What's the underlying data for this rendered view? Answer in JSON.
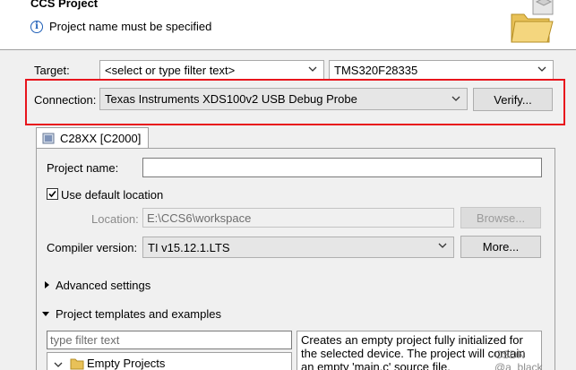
{
  "header": {
    "title": "CCS Project",
    "message": "Project name must be specified"
  },
  "target": {
    "label": "Target:",
    "filter_value": "<select or type filter text>",
    "device_value": "TMS320F28335"
  },
  "connection": {
    "label": "Connection:",
    "value": "Texas Instruments XDS100v2 USB Debug Probe",
    "verify_label": "Verify..."
  },
  "tab": {
    "label": "C28XX [C2000]"
  },
  "form": {
    "project_name_label": "Project name:",
    "project_name_value": "",
    "use_default_label": "Use default location",
    "use_default_checked": true,
    "location_label": "Location:",
    "location_value": "E:\\CCS6\\workspace",
    "browse_label": "Browse...",
    "compiler_label": "Compiler version:",
    "compiler_value": "TI v15.12.1.LTS",
    "more_label": "More..."
  },
  "sections": {
    "advanced": "Advanced settings",
    "templates": "Project templates and examples"
  },
  "templates": {
    "filter_placeholder": "type filter text",
    "tree_item": "Empty Projects",
    "description": "Creates an empty project fully initialized for the selected device. The project will contain an empty 'main.c' source file."
  },
  "watermark": "CSDN @a_black_",
  "colors": {
    "highlight": "#e8141c",
    "folder": "#e8c158",
    "info": "#1f5fb7"
  }
}
